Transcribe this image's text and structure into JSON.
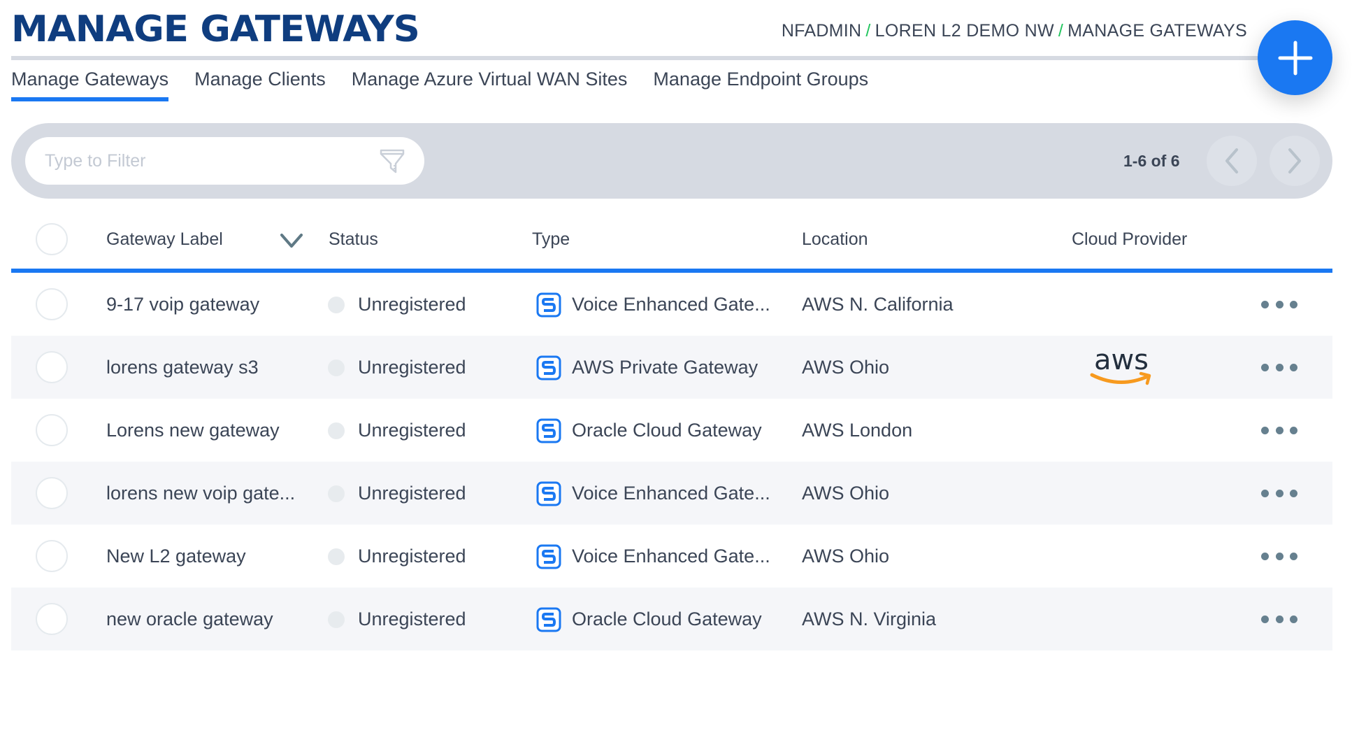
{
  "header": {
    "title": "MANAGE GATEWAYS",
    "breadcrumb": [
      "NFADMIN",
      "LOREN L2 DEMO NW",
      "MANAGE GATEWAYS"
    ],
    "breadcrumb_separator": "/",
    "add_button_icon": "plus-icon"
  },
  "tabs": [
    {
      "label": "Manage Gateways",
      "active": true
    },
    {
      "label": "Manage Clients",
      "active": false
    },
    {
      "label": "Manage Azure Virtual WAN Sites",
      "active": false
    },
    {
      "label": "Manage Endpoint Groups",
      "active": false
    }
  ],
  "toolbar": {
    "filter_placeholder": "Type to Filter",
    "filter_value": "",
    "filter_icon": "funnel-icon",
    "pagination": "1-6 of 6",
    "prev_icon": "chevron-left-icon",
    "next_icon": "chevron-right-icon"
  },
  "table": {
    "columns": [
      "Gateway Label",
      "Status",
      "Type",
      "Location",
      "Cloud Provider"
    ],
    "sort_icon": "chevron-down-icon",
    "rows": [
      {
        "label": "9-17 voip gateway",
        "status": "Unregistered",
        "type": "Voice Enhanced Gate...",
        "location": "AWS N. California",
        "cloud_provider": ""
      },
      {
        "label": "lorens gateway s3",
        "status": "Unregistered",
        "type": "AWS Private Gateway",
        "location": "AWS Ohio",
        "cloud_provider": "aws"
      },
      {
        "label": "Lorens new gateway",
        "status": "Unregistered",
        "type": "Oracle Cloud Gateway",
        "location": "AWS London",
        "cloud_provider": ""
      },
      {
        "label": "lorens new voip gate...",
        "status": "Unregistered",
        "type": "Voice Enhanced Gate...",
        "location": "AWS Ohio",
        "cloud_provider": ""
      },
      {
        "label": "New L2 gateway",
        "status": "Unregistered",
        "type": "Voice Enhanced Gate...",
        "location": "AWS Ohio",
        "cloud_provider": ""
      },
      {
        "label": "new oracle gateway",
        "status": "Unregistered",
        "type": "Oracle Cloud Gateway",
        "location": "AWS N. Virginia",
        "cloud_provider": ""
      }
    ]
  },
  "colors": {
    "title": "#0f3d7f",
    "accent": "#1a78f2",
    "breadcrumb_separator": "#22c55e",
    "toolbar_bg": "#d6dae2",
    "row_alt_bg": "#f5f6f9",
    "status_unregistered": "#e7ebee",
    "aws_orange": "#f79a1f"
  }
}
